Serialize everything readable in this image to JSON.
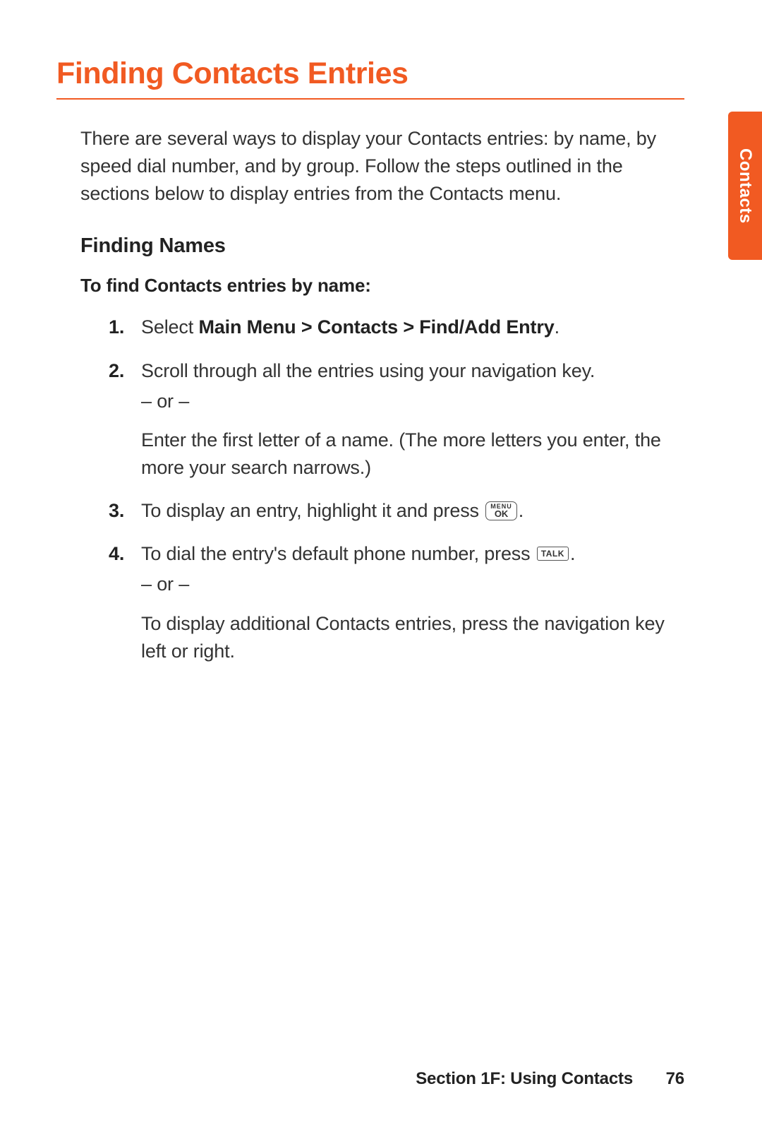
{
  "title": "Finding Contacts Entries",
  "intro": "There are several ways to display your Contacts entries: by name, by speed dial number, and by group. Follow the steps outlined in the sections below to display entries from the Contacts menu.",
  "subhead": "Finding Names",
  "instruction": "To find Contacts entries by name:",
  "steps": {
    "s1_num": "1.",
    "s1_a": "Select ",
    "s1_b": "Main Menu > Contacts > Find/Add Entry",
    "s1_c": ".",
    "s2_num": "2.",
    "s2_a": "Scroll through all the entries using your navigation key.",
    "s2_or": "– or –",
    "s2_b": "Enter the first letter of a name. (The more letters you enter, the more your search narrows.)",
    "s3_num": "3.",
    "s3_a": "To display an entry, highlight it and press ",
    "s3_c": ".",
    "s4_num": "4.",
    "s4_a": "To dial the entry's default phone number, press ",
    "s4_c": ".",
    "s4_or": "– or –",
    "s4_b": "To display additional Contacts entries, press the navigation key left or right."
  },
  "keys": {
    "menuok_top": "MENU",
    "menuok_bot": "OK",
    "talk": "TALK"
  },
  "sidetab": "Contacts",
  "footer_section": "Section 1F: Using Contacts",
  "footer_page": "76"
}
